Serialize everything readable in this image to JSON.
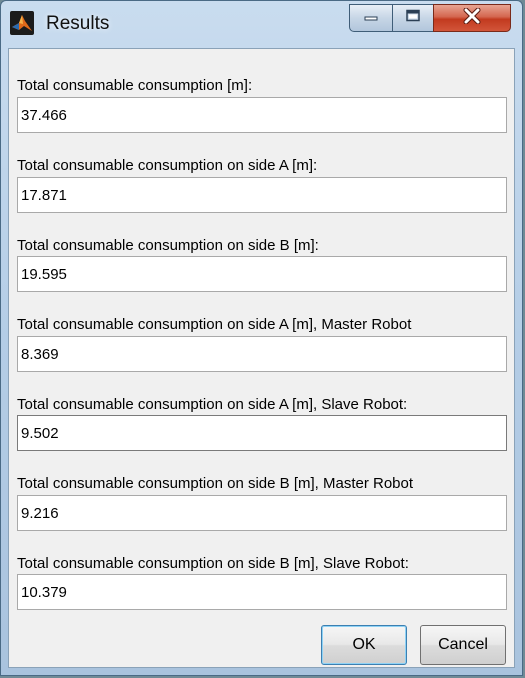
{
  "window": {
    "title": "Results",
    "icon": "matlab-icon",
    "controls": [
      "minimize-icon",
      "maximize-icon",
      "close-icon"
    ]
  },
  "fields": [
    {
      "label": "Total consumable consumption [m]:",
      "value": "37.466"
    },
    {
      "label": "Total consumable consumption on side A [m]:",
      "value": "17.871"
    },
    {
      "label": "Total consumable consumption on side B [m]:",
      "value": "19.595"
    },
    {
      "label": "Total consumable consumption on side A [m], Master Robot",
      "value": "8.369"
    },
    {
      "label": "Total consumable consumption on side A [m], Slave Robot:",
      "value": "9.502"
    },
    {
      "label": "Total consumable consumption on side B [m], Master Robot",
      "value": "9.216"
    },
    {
      "label": "Total consumable consumption on side B [m], Slave Robot:",
      "value": "10.379"
    }
  ],
  "buttons": {
    "ok": "OK",
    "cancel": "Cancel"
  },
  "colors": {
    "titlebar": "#b4cde6",
    "close": "#c23a1f",
    "content": "#f0f0f0"
  }
}
